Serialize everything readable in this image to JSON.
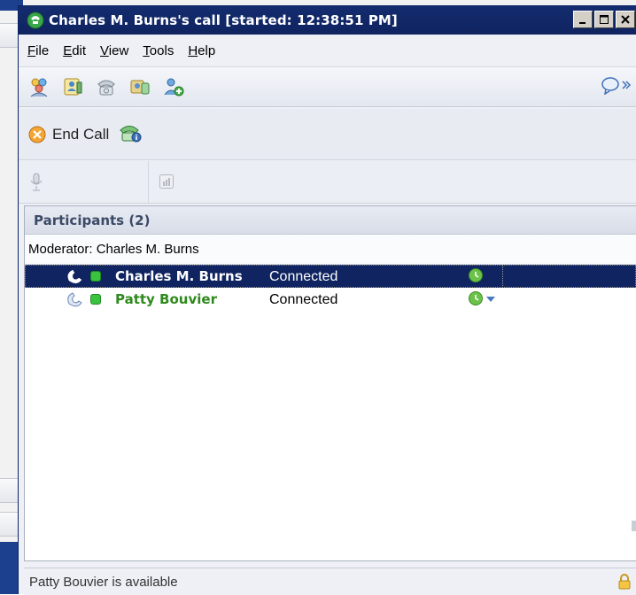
{
  "window": {
    "title": "Charles M. Burns's call [started: 12:38:51 PM]",
    "controls": [
      "minimize",
      "maximize",
      "close"
    ]
  },
  "menu": {
    "items": [
      {
        "label": "File"
      },
      {
        "label": "Edit"
      },
      {
        "label": "View"
      },
      {
        "label": "Tools"
      },
      {
        "label": "Help"
      }
    ]
  },
  "toolbar": {
    "icons": [
      "contacts-icon",
      "contact-card-icon",
      "phone-icon",
      "conference-icon",
      "add-participant-icon"
    ],
    "right_icon": "chat-bubble-icon"
  },
  "call_actions": {
    "end_call_label": "End Call"
  },
  "participants": {
    "header": "Participants (2)",
    "moderator": "Moderator: Charles M. Burns",
    "rows": [
      {
        "name": "Charles M. Burns",
        "state": "Connected",
        "selected": true
      },
      {
        "name": "Patty Bouvier",
        "state": "Connected",
        "selected": false
      }
    ]
  },
  "status_bar": {
    "text": "Patty Bouvier is available"
  },
  "colors": {
    "title_bar": "#0f2360",
    "selection": "#0f2460",
    "participant_name_green": "#2e8a1d",
    "presence_green": "#39c33f"
  }
}
